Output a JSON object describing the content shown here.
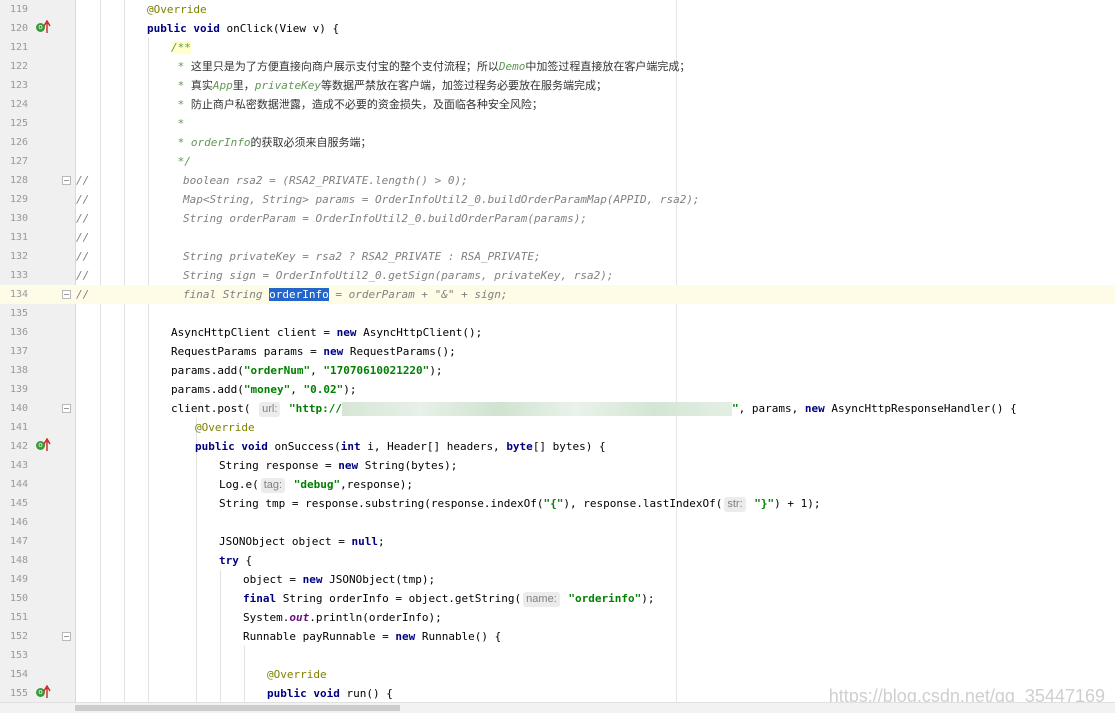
{
  "editor": {
    "watermark": "https://blog.csdn.net/qq_35447169",
    "lines": [
      {
        "n": "119",
        "parts": [
          [
            "ann",
            "@Override"
          ]
        ]
      },
      {
        "n": "120",
        "parts": [
          [
            "kw",
            "public"
          ],
          [
            "txt",
            " "
          ],
          [
            "kw",
            "void"
          ],
          [
            "txt",
            " onClick(View v) {"
          ]
        ]
      },
      {
        "n": "121",
        "parts": [
          [
            "doc",
            "/**"
          ]
        ]
      },
      {
        "n": "122",
        "parts": [
          [
            "doc",
            " * "
          ],
          [
            "doc-cn",
            "这里只是为了方便直接向商户展示支付宝的整个支付流程；所以"
          ],
          [
            "doc",
            "Demo"
          ],
          [
            "doc-cn",
            "中加签过程直接放在客户端完成；"
          ]
        ]
      },
      {
        "n": "123",
        "parts": [
          [
            "doc",
            " * "
          ],
          [
            "doc-cn",
            "真实"
          ],
          [
            "doc",
            "App"
          ],
          [
            "doc-cn",
            "里，"
          ],
          [
            "doc",
            "privateKey"
          ],
          [
            "doc-cn",
            "等数据严禁放在客户端，加签过程务必要放在服务端完成；"
          ]
        ]
      },
      {
        "n": "124",
        "parts": [
          [
            "doc",
            " * "
          ],
          [
            "doc-cn",
            "防止商户私密数据泄露，造成不必要的资金损失，及面临各种安全风险；"
          ]
        ]
      },
      {
        "n": "125",
        "parts": [
          [
            "doc",
            " *"
          ]
        ]
      },
      {
        "n": "126",
        "parts": [
          [
            "doc",
            " * orderInfo"
          ],
          [
            "doc-cn",
            "的获取必须来自服务端；"
          ]
        ]
      },
      {
        "n": "127",
        "parts": [
          [
            "doc",
            " */"
          ]
        ]
      },
      {
        "n": "128",
        "parts": [
          [
            "cmt",
            "boolean rsa2 = (RSA2_PRIVATE.length() > 0);"
          ]
        ]
      },
      {
        "n": "129",
        "parts": [
          [
            "cmt",
            "Map<String, String> params = OrderInfoUtil2_0.buildOrderParamMap(APPID, rsa2);"
          ]
        ]
      },
      {
        "n": "130",
        "parts": [
          [
            "cmt",
            "String orderParam = OrderInfoUtil2_0.buildOrderParam(params);"
          ]
        ]
      },
      {
        "n": "131",
        "parts": []
      },
      {
        "n": "132",
        "parts": [
          [
            "cmt",
            "String privateKey = rsa2 ? RSA2_PRIVATE : RSA_PRIVATE;"
          ]
        ]
      },
      {
        "n": "133",
        "parts": [
          [
            "cmt",
            "String sign = OrderInfoUtil2_0.getSign(params, privateKey, rsa2);"
          ]
        ]
      },
      {
        "n": "134",
        "parts": [
          [
            "cmt",
            "final String "
          ],
          [
            "sel",
            "orderInfo"
          ],
          [
            "cmt",
            " = orderParam + \"&\" + sign;"
          ]
        ]
      },
      {
        "n": "135",
        "parts": []
      },
      {
        "n": "136",
        "parts": [
          [
            "txt",
            "AsyncHttpClient client = "
          ],
          [
            "kw",
            "new"
          ],
          [
            "txt",
            " AsyncHttpClient();"
          ]
        ]
      },
      {
        "n": "137",
        "parts": [
          [
            "txt",
            "RequestParams params = "
          ],
          [
            "kw",
            "new"
          ],
          [
            "txt",
            " RequestParams();"
          ]
        ]
      },
      {
        "n": "138",
        "parts": [
          [
            "txt",
            "params.add("
          ],
          [
            "str",
            "\"orderNum\""
          ],
          [
            "txt",
            ", "
          ],
          [
            "str",
            "\"17070610021220\""
          ],
          [
            "txt",
            ");"
          ]
        ]
      },
      {
        "n": "139",
        "parts": [
          [
            "txt",
            "params.add("
          ],
          [
            "str",
            "\"money\""
          ],
          [
            "txt",
            ", "
          ],
          [
            "str",
            "\"0.02\""
          ],
          [
            "txt",
            ");"
          ]
        ]
      },
      {
        "n": "140",
        "parts": [
          [
            "txt",
            "client.post( "
          ],
          [
            "hint",
            "url:"
          ],
          [
            "str",
            " \"http://"
          ],
          [
            "blur",
            ""
          ],
          [
            "str",
            "\""
          ],
          [
            "txt",
            ", params, "
          ],
          [
            "kw",
            "new"
          ],
          [
            "txt",
            " AsyncHttpResponseHandler() {"
          ]
        ]
      },
      {
        "n": "141",
        "parts": [
          [
            "ann",
            "@Override"
          ]
        ]
      },
      {
        "n": "142",
        "parts": [
          [
            "kw",
            "public"
          ],
          [
            "txt",
            " "
          ],
          [
            "kw",
            "void"
          ],
          [
            "txt",
            " onSuccess("
          ],
          [
            "kw",
            "int"
          ],
          [
            "txt",
            " i, Header[] headers, "
          ],
          [
            "kw",
            "byte"
          ],
          [
            "txt",
            "[] bytes) {"
          ]
        ]
      },
      {
        "n": "143",
        "parts": [
          [
            "txt",
            "String response = "
          ],
          [
            "kw",
            "new"
          ],
          [
            "txt",
            " String(bytes);"
          ]
        ]
      },
      {
        "n": "144",
        "parts": [
          [
            "txt",
            "Log."
          ],
          [
            "txt",
            "e("
          ],
          [
            "hint",
            "tag:"
          ],
          [
            "str",
            " \"debug\""
          ],
          [
            "txt",
            ",response);"
          ]
        ]
      },
      {
        "n": "145",
        "parts": [
          [
            "txt",
            "String tmp = response.substring(response.indexOf("
          ],
          [
            "str",
            "\"{\""
          ],
          [
            "txt",
            "), response.lastIndexOf("
          ],
          [
            "hint",
            "str:"
          ],
          [
            "str",
            " \"}\""
          ],
          [
            "txt",
            ") + "
          ],
          [
            "num",
            "1"
          ],
          [
            "txt",
            ");"
          ]
        ]
      },
      {
        "n": "146",
        "parts": []
      },
      {
        "n": "147",
        "parts": [
          [
            "txt",
            "JSONObject object = "
          ],
          [
            "kw",
            "null"
          ],
          [
            "txt",
            ";"
          ]
        ]
      },
      {
        "n": "148",
        "parts": [
          [
            "kw",
            "try"
          ],
          [
            "txt",
            " {"
          ]
        ]
      },
      {
        "n": "149",
        "parts": [
          [
            "txt",
            "object = "
          ],
          [
            "kw",
            "new"
          ],
          [
            "txt",
            " JSONObject(tmp);"
          ]
        ]
      },
      {
        "n": "150",
        "parts": [
          [
            "kw",
            "final"
          ],
          [
            "txt",
            " String orderInfo = object.getString("
          ],
          [
            "hint",
            "name:"
          ],
          [
            "str",
            " \"orderinfo\""
          ],
          [
            "txt",
            ");"
          ]
        ]
      },
      {
        "n": "151",
        "parts": [
          [
            "txt",
            "System."
          ],
          [
            "field",
            "out"
          ],
          [
            "txt",
            ".println(orderInfo);"
          ]
        ]
      },
      {
        "n": "152",
        "parts": [
          [
            "txt",
            "Runnable payRunnable = "
          ],
          [
            "kw",
            "new"
          ],
          [
            "txt",
            " Runnable() {"
          ]
        ]
      },
      {
        "n": "153",
        "parts": []
      },
      {
        "n": "154",
        "parts": [
          [
            "ann",
            "@Override"
          ]
        ]
      },
      {
        "n": "155",
        "parts": [
          [
            "kw",
            "public"
          ],
          [
            "txt",
            " "
          ],
          [
            "kw",
            "void"
          ],
          [
            "txt",
            " run() {"
          ]
        ]
      }
    ]
  }
}
